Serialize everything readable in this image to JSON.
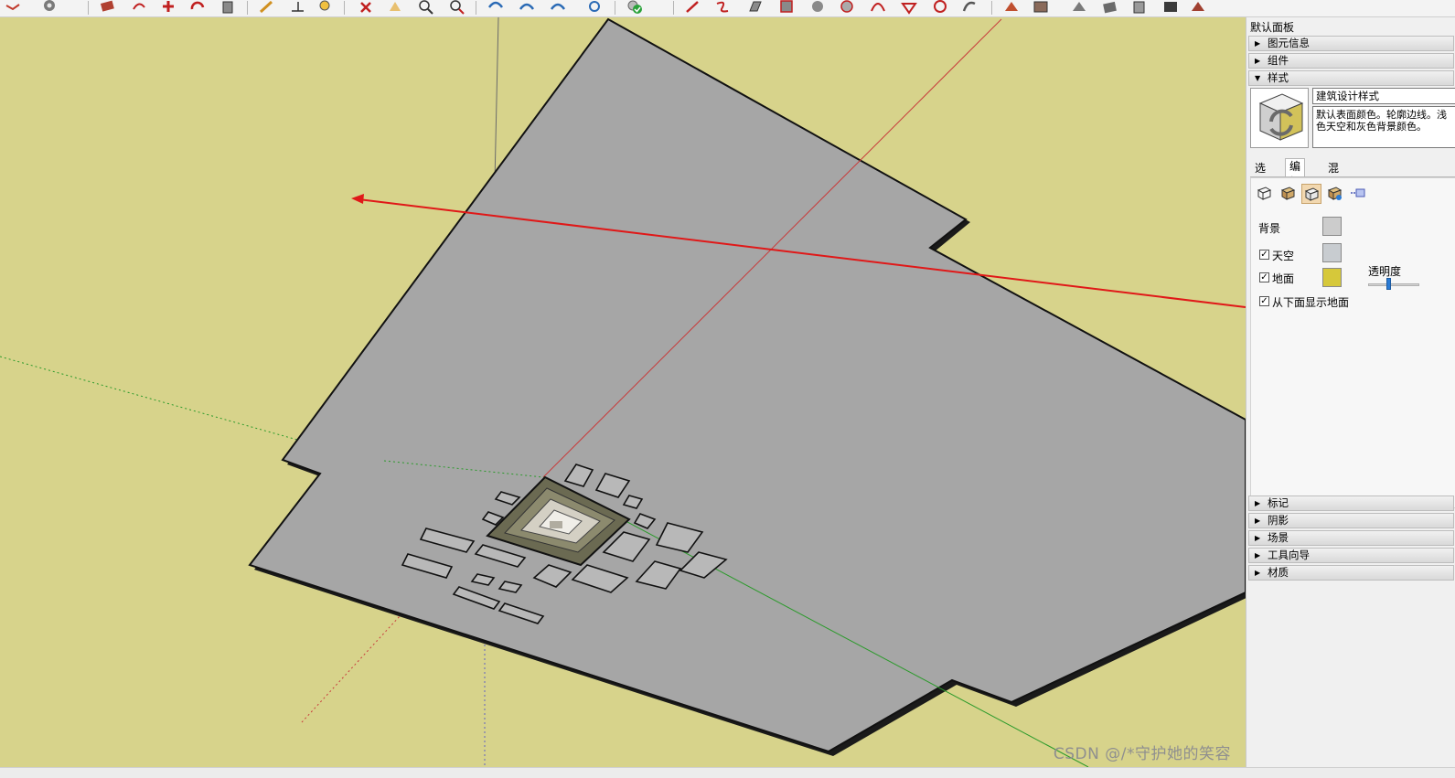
{
  "panel": {
    "title": "默认面板",
    "trays_top": [
      {
        "label": "图元信息",
        "expanded": false
      },
      {
        "label": "组件",
        "expanded": false
      },
      {
        "label": "样式",
        "expanded": true
      }
    ],
    "style": {
      "name": "建筑设计样式",
      "description": "默认表面颜色。轮廓边线。浅色天空和灰色背景颜色。"
    },
    "tabs": [
      {
        "label": "选择",
        "active": false
      },
      {
        "label": "编辑",
        "active": true
      },
      {
        "label": "混合",
        "active": false
      }
    ],
    "edit_icons": [
      "edge-settings-icon",
      "face-settings-icon",
      "background-settings-icon",
      "watermark-settings-icon",
      "modeling-settings-icon"
    ],
    "background": {
      "label": "背景",
      "sky_label": "天空",
      "ground_label": "地面",
      "show_ground_from_below_label": "从下面显示地面",
      "opacity_label": "透明度",
      "sky_checked": true,
      "ground_checked": true,
      "show_from_below_checked": true,
      "background_color": "#cccccc",
      "sky_color": "#c8ccd0",
      "ground_color": "#d6c83a",
      "opacity_percent": 40
    },
    "trays_bottom": [
      {
        "label": "标记",
        "expanded": false
      },
      {
        "label": "阴影",
        "expanded": false
      },
      {
        "label": "场景",
        "expanded": false
      },
      {
        "label": "工具向导",
        "expanded": false
      },
      {
        "label": "材质",
        "expanded": false
      }
    ]
  },
  "viewport": {
    "watermark": "CSDN @/*守护她的笑容",
    "colors": {
      "ground": "#d7d38b",
      "plane": "#a6a6a6",
      "red_axis": "#c83c3c",
      "green_axis": "#2a9a2a",
      "annotation": "#e01818"
    }
  },
  "toolbar": {
    "icons": [
      "orbit-icon",
      "select-icon",
      "eraser-icon",
      "paint-icon",
      "move-icon",
      "rotate-icon",
      "scale-icon",
      "pencil-icon",
      "tape-icon",
      "zoom-icon",
      "zoom-extents-icon",
      "section-icon",
      "layers-icon",
      "warehouse-icon",
      "check-icon",
      "line-icon",
      "arc-icon",
      "rectangle-icon",
      "circle-icon",
      "polygon-icon",
      "pushpull-icon",
      "offset-icon",
      "followme-icon",
      "intersect-icon",
      "sandbox-icon",
      "terrain-icon",
      "stamp-icon",
      "drape-icon",
      "flip-icon",
      "smoove-icon"
    ]
  }
}
